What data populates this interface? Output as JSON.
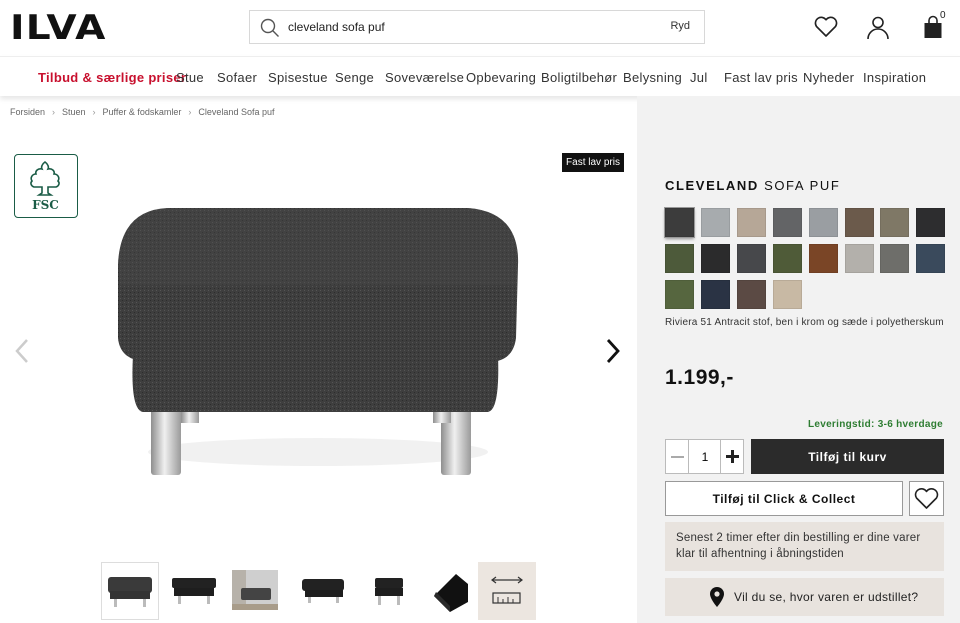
{
  "header": {
    "logo": "ILVA",
    "search_value": "cleveland sofa puf",
    "clear_label": "Ryd",
    "cart_count": "0"
  },
  "nav": [
    "Tilbud & særlige priser",
    "Stue",
    "Sofaer",
    "Spisestue",
    "Senge",
    "Soveværelse",
    "Opbevaring",
    "Boligtilbehør",
    "Belysning",
    "Jul",
    "Fast lav pris",
    "Nyheder",
    "Inspiration"
  ],
  "breadcrumb": [
    "Forsiden",
    "Stuen",
    "Puffer & fodskamler",
    "Cleveland Sofa puf"
  ],
  "gallery": {
    "badge": "Fast lav pris",
    "fsc_text": "FSC"
  },
  "product": {
    "title_bold": "CLEVELAND",
    "title_rest": "SOFA PUF",
    "description": "Riviera 51 Antracit stof, ben i krom og sæde i polyetherskum",
    "price": "1.199,-",
    "delivery": "Leveringstid: 3-6 hverdage",
    "quantity": "1",
    "add_to_cart": "Tilføj til kurv",
    "click_collect": "Tilføj til Click & Collect",
    "pickup_info": "Senest 2 timer efter din bestilling er dine varer klar til afhentning i åbningstiden",
    "show_where": "Vil du se, hvor varen er udstillet?"
  },
  "swatches": [
    {
      "color": "#3c3c3c",
      "selected": true
    },
    {
      "color": "#a7abae"
    },
    {
      "color": "#b6a797"
    },
    {
      "color": "#636466"
    },
    {
      "color": "#9a9ea2"
    },
    {
      "color": "#6b5a4b"
    },
    {
      "color": "#7f7866"
    },
    {
      "color": "#2d2d2f"
    },
    {
      "color": "#4d5a3a"
    },
    {
      "color": "#2b2b2c"
    },
    {
      "color": "#47484b"
    },
    {
      "color": "#4f5b38"
    },
    {
      "color": "#7a4526"
    },
    {
      "color": "#b3b0ab"
    },
    {
      "color": "#6e6e6a"
    },
    {
      "color": "#3a4a5c"
    },
    {
      "color": "#56663f"
    },
    {
      "color": "#2a3344"
    },
    {
      "color": "#5b4a44"
    },
    {
      "color": "#c8b9a4"
    }
  ]
}
